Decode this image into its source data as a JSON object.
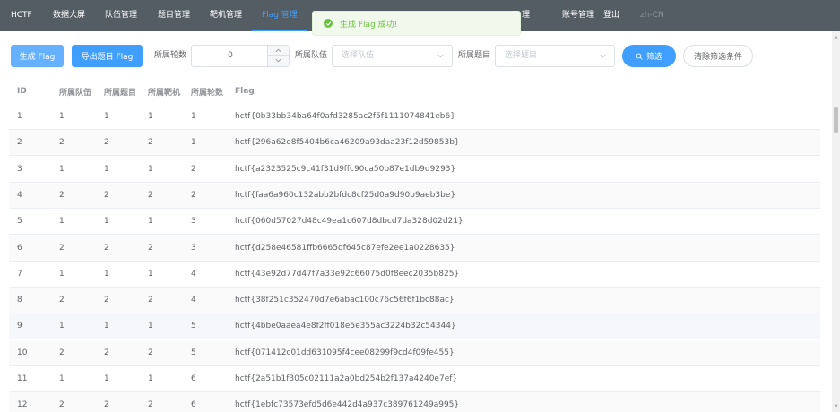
{
  "nav": {
    "items": [
      {
        "label": "HCTF"
      },
      {
        "label": "数据大屏"
      },
      {
        "label": "队伍管理"
      },
      {
        "label": "题目管理"
      },
      {
        "label": "靶机管理"
      },
      {
        "label": "Flag 管理"
      },
      {
        "label": "理"
      },
      {
        "label": "账号管理"
      },
      {
        "label": "登出"
      },
      {
        "label": "zh-CN"
      }
    ],
    "active_index": 5
  },
  "toast": {
    "message": "生成 Flag 成功!",
    "color": "#67c23a"
  },
  "toolbar": {
    "generate_label": "生成 Flag",
    "export_label": "导出题目 Flag",
    "round_label": "所属轮数",
    "round_value": "0",
    "team_label": "所属队伍",
    "team_placeholder": "选择队伍",
    "challenge_label": "所属题目",
    "challenge_placeholder": "选择题目",
    "filter_label": "筛选",
    "clear_label": "清除筛选条件"
  },
  "table": {
    "headers": [
      "ID",
      "所属队伍",
      "所属题目",
      "所属靶机",
      "所属轮数",
      "Flag"
    ],
    "rows": [
      [
        "1",
        "1",
        "1",
        "1",
        "1",
        "hctf{0b33bb34ba64f0afd3285ac2f5f1111074841eb6}"
      ],
      [
        "2",
        "2",
        "2",
        "2",
        "1",
        "hctf{296a62e8f5404b6ca46209a93daa23f12d59853b}"
      ],
      [
        "3",
        "1",
        "1",
        "1",
        "2",
        "hctf{a2323525c9c41f31d9ffc90ca50b87e1db9d9293}"
      ],
      [
        "4",
        "2",
        "2",
        "2",
        "2",
        "hctf{faa6a960c132abb2bfdc8cf25d0a9d90b9aeb3be}"
      ],
      [
        "5",
        "1",
        "1",
        "1",
        "3",
        "hctf{060d57027d48c49ea1c607d8dbcd7da328d02d21}"
      ],
      [
        "6",
        "2",
        "2",
        "2",
        "3",
        "hctf{d258e46581ffb6665df645c87efe2ee1a0228635}"
      ],
      [
        "7",
        "1",
        "1",
        "1",
        "4",
        "hctf{43e92d77d47f7a33e92c66075d0f8eec2035b825}"
      ],
      [
        "8",
        "2",
        "2",
        "2",
        "4",
        "hctf{38f251c352470d7e6abac100c76c56f6f1bc88ac}"
      ],
      [
        "9",
        "1",
        "1",
        "1",
        "5",
        "hctf{4bbe0aaea4e8f2ff018e5e355ac3224b32c54344}"
      ],
      [
        "10",
        "2",
        "2",
        "2",
        "5",
        "hctf{071412c01dd631095f4cee08299f9cd4f09fe455}"
      ],
      [
        "11",
        "1",
        "1",
        "1",
        "6",
        "hctf{2a51b1f305c02111a2a0bd254b2f137a4240e7ef}"
      ],
      [
        "12",
        "2",
        "2",
        "2",
        "6",
        "hctf{1ebfc73573efd5d6e442d4a937c389761249a995}"
      ]
    ]
  },
  "colors": {
    "nav_bg": "#545c64",
    "accent": "#409eff",
    "success": "#67c23a"
  }
}
